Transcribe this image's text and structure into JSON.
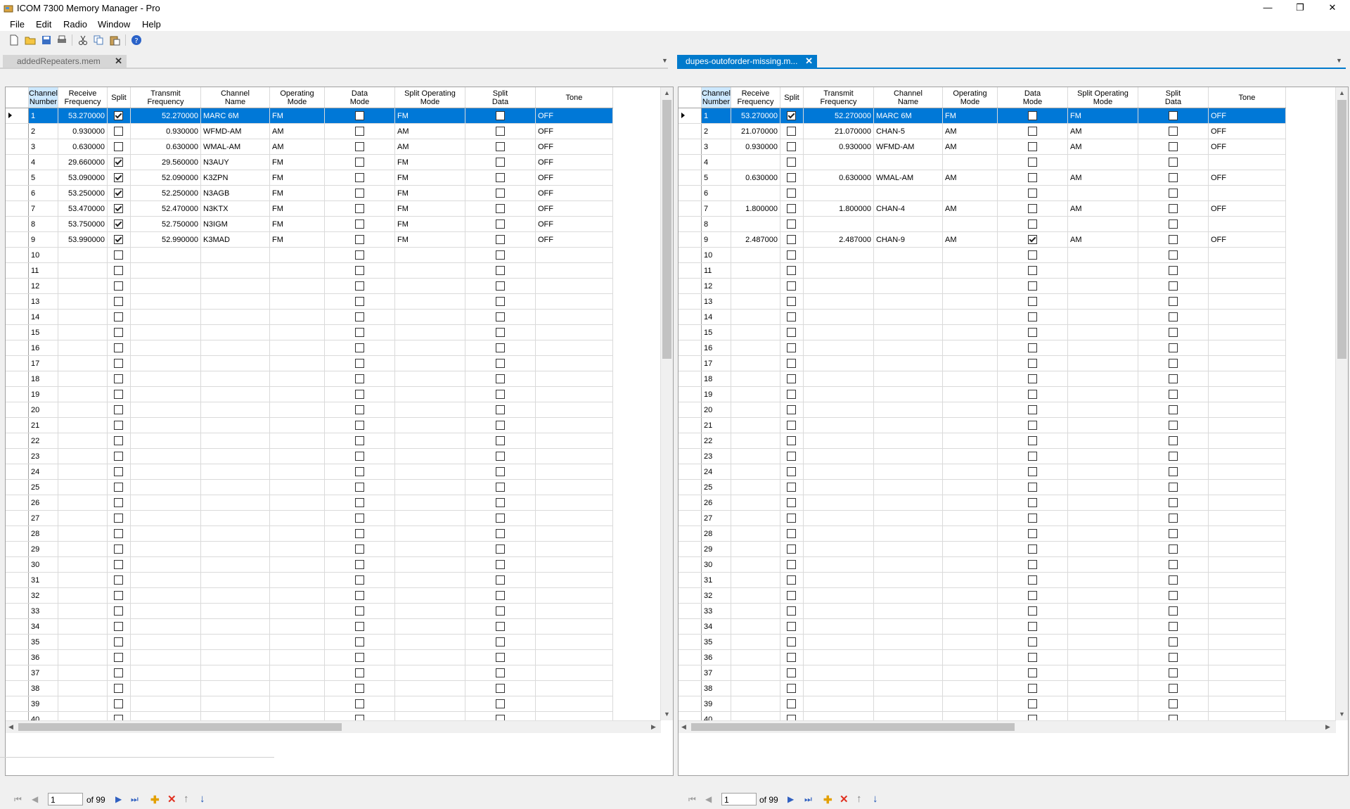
{
  "window": {
    "title": "ICOM 7300 Memory Manager - Pro",
    "minimize": "—",
    "maximize": "❐",
    "close": "✕"
  },
  "menu": [
    "File",
    "Edit",
    "Radio",
    "Window",
    "Help"
  ],
  "columns": [
    "Channel\nNumber",
    "Receive\nFrequency",
    "Split",
    "Transmit\nFrequency",
    "Channel\nName",
    "Operating\nMode",
    "Data\nMode",
    "Split Operating\nMode",
    "Split\nData",
    "Tone"
  ],
  "panes": [
    {
      "tab_label": "addedRepeaters.mem",
      "active": false,
      "position": "1",
      "of_label": "of 99",
      "total_rows": 40,
      "rows": [
        {
          "ch": "1",
          "rx": "53.270000",
          "split": true,
          "tx": "52.270000",
          "name": "MARC 6M",
          "mode": "FM",
          "data": false,
          "smode": "FM",
          "sdata": false,
          "tone": "OFF"
        },
        {
          "ch": "2",
          "rx": "0.930000",
          "split": false,
          "tx": "0.930000",
          "name": "WFMD-AM",
          "mode": "AM",
          "data": false,
          "smode": "AM",
          "sdata": false,
          "tone": "OFF"
        },
        {
          "ch": "3",
          "rx": "0.630000",
          "split": false,
          "tx": "0.630000",
          "name": "WMAL-AM",
          "mode": "AM",
          "data": false,
          "smode": "AM",
          "sdata": false,
          "tone": "OFF"
        },
        {
          "ch": "4",
          "rx": "29.660000",
          "split": true,
          "tx": "29.560000",
          "name": "N3AUY",
          "mode": "FM",
          "data": false,
          "smode": "FM",
          "sdata": false,
          "tone": "OFF"
        },
        {
          "ch": "5",
          "rx": "53.090000",
          "split": true,
          "tx": "52.090000",
          "name": "K3ZPN",
          "mode": "FM",
          "data": false,
          "smode": "FM",
          "sdata": false,
          "tone": "OFF"
        },
        {
          "ch": "6",
          "rx": "53.250000",
          "split": true,
          "tx": "52.250000",
          "name": "N3AGB",
          "mode": "FM",
          "data": false,
          "smode": "FM",
          "sdata": false,
          "tone": "OFF"
        },
        {
          "ch": "7",
          "rx": "53.470000",
          "split": true,
          "tx": "52.470000",
          "name": "N3KTX",
          "mode": "FM",
          "data": false,
          "smode": "FM",
          "sdata": false,
          "tone": "OFF"
        },
        {
          "ch": "8",
          "rx": "53.750000",
          "split": true,
          "tx": "52.750000",
          "name": "N3IGM",
          "mode": "FM",
          "data": false,
          "smode": "FM",
          "sdata": false,
          "tone": "OFF"
        },
        {
          "ch": "9",
          "rx": "53.990000",
          "split": true,
          "tx": "52.990000",
          "name": "K3MAD",
          "mode": "FM",
          "data": false,
          "smode": "FM",
          "sdata": false,
          "tone": "OFF"
        }
      ]
    },
    {
      "tab_label": "dupes-outoforder-missing.m...",
      "active": true,
      "position": "1",
      "of_label": "of 99",
      "total_rows": 40,
      "rows": [
        {
          "ch": "1",
          "rx": "53.270000",
          "split": true,
          "tx": "52.270000",
          "name": "MARC 6M",
          "mode": "FM",
          "data": false,
          "smode": "FM",
          "sdata": false,
          "tone": "OFF"
        },
        {
          "ch": "2",
          "rx": "21.070000",
          "split": false,
          "tx": "21.070000",
          "name": "CHAN-5",
          "mode": "AM",
          "data": false,
          "smode": "AM",
          "sdata": false,
          "tone": "OFF"
        },
        {
          "ch": "3",
          "rx": "0.930000",
          "split": false,
          "tx": "0.930000",
          "name": "WFMD-AM",
          "mode": "AM",
          "data": false,
          "smode": "AM",
          "sdata": false,
          "tone": "OFF"
        },
        {
          "ch": "4",
          "rx": "",
          "split": false,
          "tx": "",
          "name": "",
          "mode": "",
          "data": false,
          "smode": "",
          "sdata": false,
          "tone": ""
        },
        {
          "ch": "5",
          "rx": "0.630000",
          "split": false,
          "tx": "0.630000",
          "name": "WMAL-AM",
          "mode": "AM",
          "data": false,
          "smode": "AM",
          "sdata": false,
          "tone": "OFF"
        },
        {
          "ch": "6",
          "rx": "",
          "split": false,
          "tx": "",
          "name": "",
          "mode": "",
          "data": false,
          "smode": "",
          "sdata": false,
          "tone": ""
        },
        {
          "ch": "7",
          "rx": "1.800000",
          "split": false,
          "tx": "1.800000",
          "name": "CHAN-4",
          "mode": "AM",
          "data": false,
          "smode": "AM",
          "sdata": false,
          "tone": "OFF"
        },
        {
          "ch": "8",
          "rx": "",
          "split": false,
          "tx": "",
          "name": "",
          "mode": "",
          "data": false,
          "smode": "",
          "sdata": false,
          "tone": ""
        },
        {
          "ch": "9",
          "rx": "2.487000",
          "split": false,
          "tx": "2.487000",
          "name": "CHAN-9",
          "mode": "AM",
          "data": true,
          "smode": "AM",
          "sdata": false,
          "tone": "OFF"
        }
      ]
    }
  ]
}
